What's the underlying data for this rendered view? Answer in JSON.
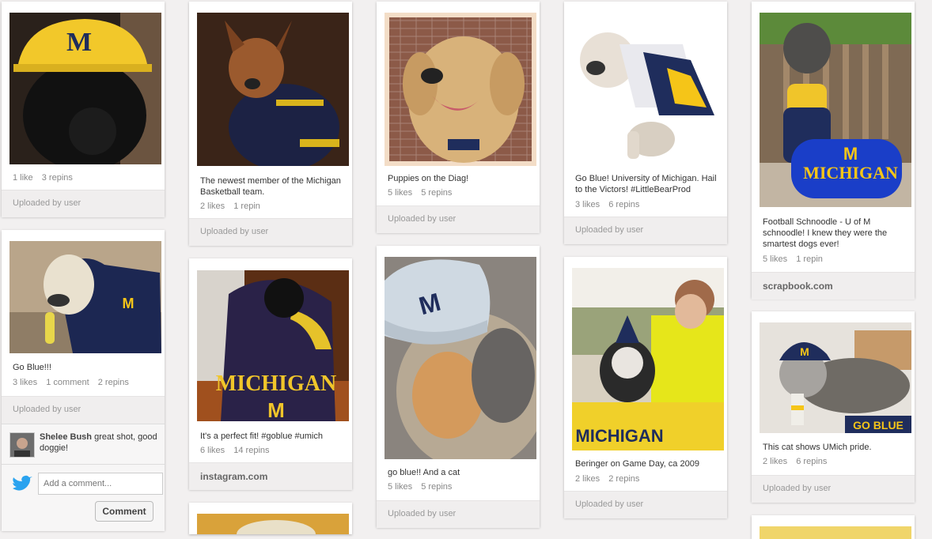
{
  "columns": [
    {
      "pins": [
        {
          "description": "",
          "likes": "1 like",
          "repins": "3 repins",
          "comments": "",
          "source": "Uploaded by user"
        },
        {
          "description": "Go Blue!!!",
          "likes": "3 likes",
          "comments": "1 comment",
          "repins": "2 repins",
          "source": "Uploaded by user",
          "comment": {
            "author": "Shelee Bush",
            "text": "great shot, good doggie!"
          },
          "add_comment": {
            "placeholder": "Add a comment...",
            "button": "Comment"
          }
        }
      ]
    },
    {
      "pins": [
        {
          "description": "The newest member of the Michigan Basketball team.",
          "likes": "2 likes",
          "repins": "1 repin",
          "source": "Uploaded by user"
        },
        {
          "description": "It's a perfect fit! #goblue #umich",
          "likes": "6 likes",
          "repins": "14 repins",
          "source": "instagram.com"
        }
      ]
    },
    {
      "pins": [
        {
          "description": "Puppies on the Diag!",
          "likes": "5 likes",
          "repins": "5 repins",
          "source": "Uploaded by user"
        },
        {
          "description": "go blue!! And a cat",
          "likes": "5 likes",
          "repins": "5 repins",
          "source": "Uploaded by user"
        }
      ]
    },
    {
      "pins": [
        {
          "description": "Go Blue! University of Michigan. Hail to the Victors! #LittleBearProd",
          "likes": "3 likes",
          "repins": "6 repins",
          "source": "Uploaded by user"
        },
        {
          "description": "Beringer on Game Day, ca 2009",
          "likes": "2 likes",
          "repins": "2 repins",
          "source": "Uploaded by user"
        }
      ]
    },
    {
      "pins": [
        {
          "description": "Football Schnoodle - U of M schnoodle! I knew they were the smartest dogs ever!",
          "likes": "5 likes",
          "repins": "1 repin",
          "source": "scrapbook.com"
        },
        {
          "description": "This cat shows UMich pride.",
          "likes": "2 likes",
          "repins": "6 repins",
          "source": "Uploaded by user"
        }
      ]
    }
  ],
  "image_texts": {
    "michigan": "MICHIGAN",
    "m": "M",
    "goblue": "GO BLUE"
  },
  "colors": {
    "maize": "#f5c518",
    "blue": "#1f2d5c",
    "source_bar": "#f0eeee",
    "twitter": "#2aa3ef"
  }
}
